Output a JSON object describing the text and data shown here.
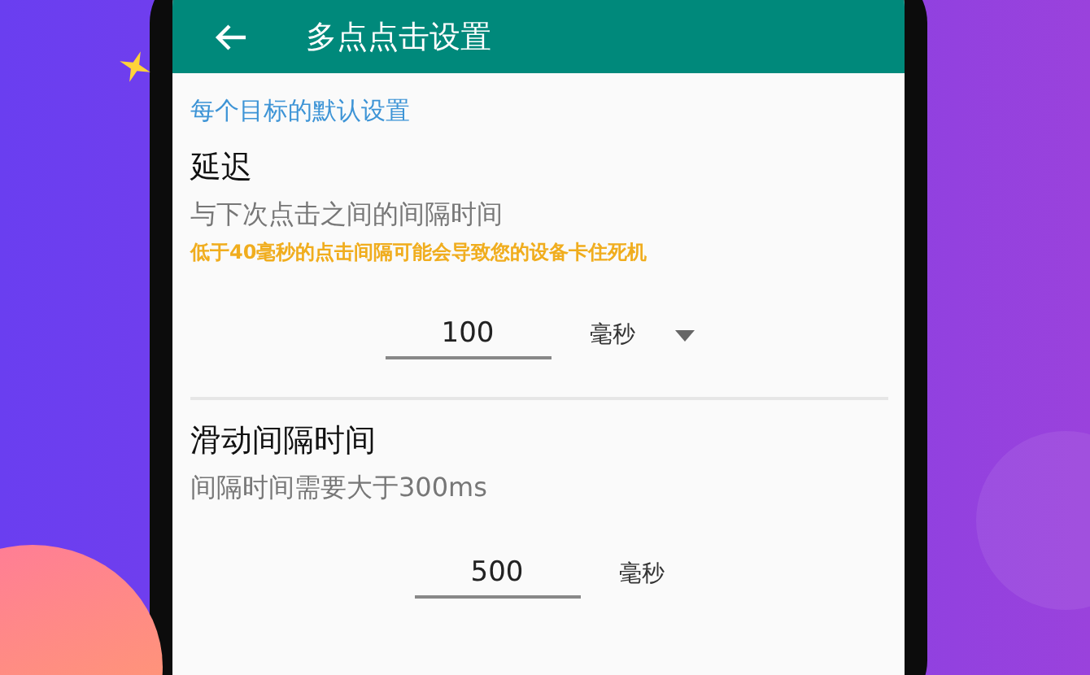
{
  "app_bar": {
    "title": "多点点击设置"
  },
  "section_label": "每个目标的默认设置",
  "settings": [
    {
      "kind": "dropdown",
      "title": "延迟",
      "subtitle": "与下次点击之间的间隔时间",
      "warning": "低于40毫秒的点击间隔可能会导致您的设备卡住死机",
      "value": "100",
      "unit": "毫秒"
    },
    {
      "kind": "plain",
      "title": "滑动间隔时间",
      "subtitle": "间隔时间需要大于300ms",
      "value": "500",
      "unit": "毫秒"
    }
  ]
}
